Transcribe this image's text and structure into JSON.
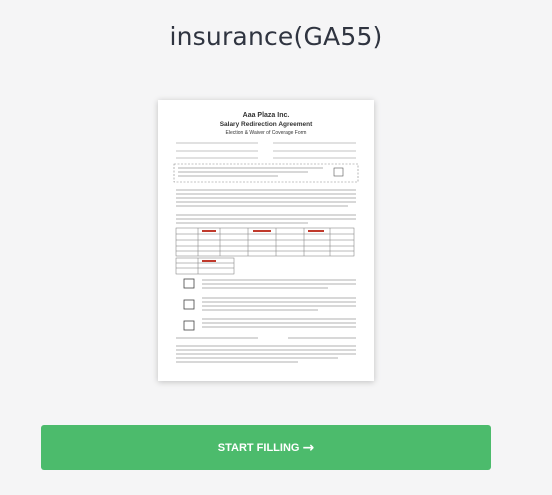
{
  "page": {
    "title": "insurance(GA55)"
  },
  "document_preview": {
    "company": "Aaa Plaza Inc.",
    "heading": "Salary Redirection Agreement",
    "subheading": "Election & Waiver of Coverage Form"
  },
  "cta": {
    "label": "START FILLING",
    "icon": "arrow-right-icon",
    "color": "#4cbb6c"
  }
}
